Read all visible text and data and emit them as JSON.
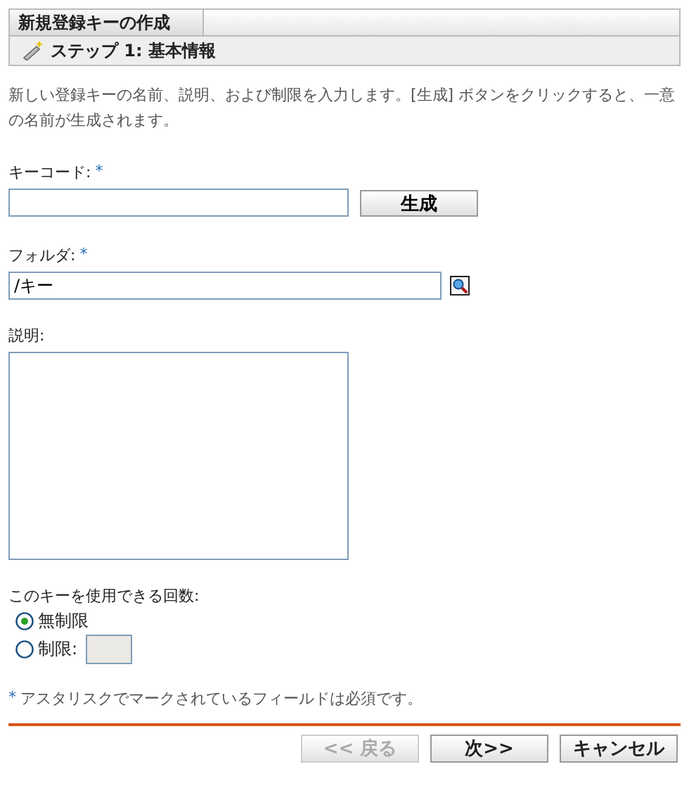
{
  "header": {
    "title": "新規登録キーの作成",
    "step": "ステップ 1: 基本情報"
  },
  "intro": "新しい登録キーの名前、説明、および制限を入力します。[生成] ボタンをクリックすると、一意の名前が生成されます。",
  "key_code": {
    "label": "キーコード:",
    "required_mark": "*",
    "generate_button": "生成"
  },
  "folder": {
    "label": "フォルダ:",
    "required_mark": "*",
    "value": "/キー"
  },
  "description": {
    "label": "説明:"
  },
  "usage": {
    "label": "このキーを使用できる回数:",
    "options": [
      {
        "kind": "plain",
        "label": "無制限",
        "selected": true
      },
      {
        "kind": "count",
        "label": "制限:",
        "selected": false
      }
    ]
  },
  "note": {
    "mark": "*",
    "text": "アスタリスクでマークされているフィールドは必須です。"
  },
  "buttons": [
    {
      "label": "<< 戻る",
      "disabled": true
    },
    {
      "label": "次>>",
      "disabled": false
    },
    {
      "label": "キャンセル",
      "disabled": false
    }
  ]
}
